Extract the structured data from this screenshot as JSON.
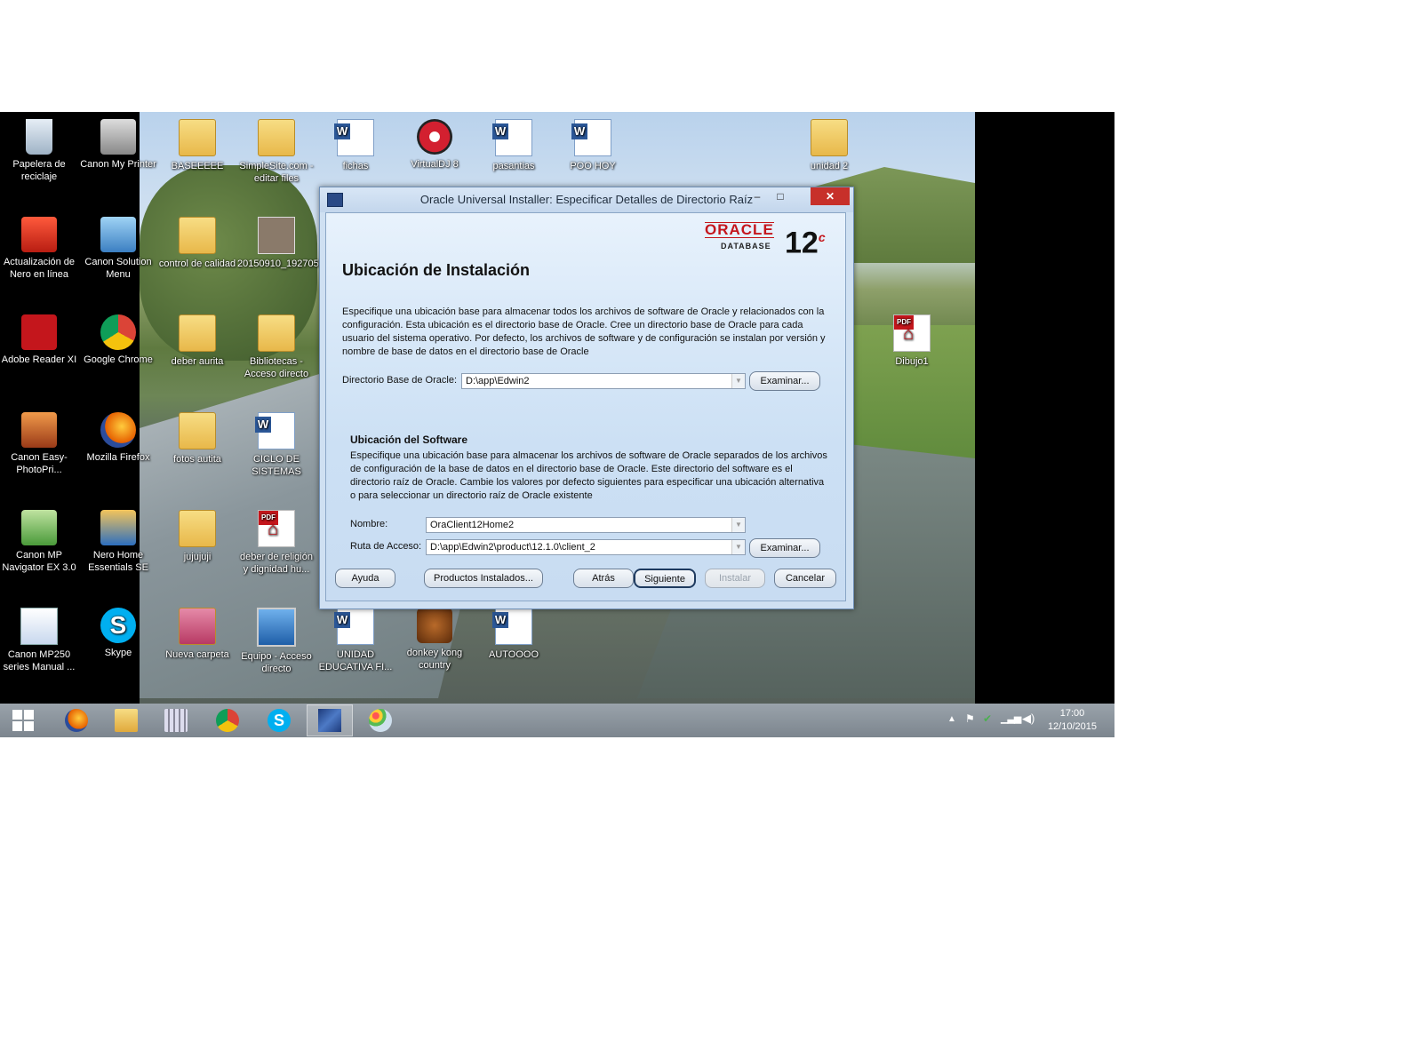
{
  "desktop": {
    "icons": [
      {
        "label": "Papelera de reciclaje"
      },
      {
        "label": "Canon My Printer"
      },
      {
        "label": "BASEEEEE"
      },
      {
        "label": "SimpleSite.com - editar files"
      },
      {
        "label": "fichas"
      },
      {
        "label": "VirtualDJ 8"
      },
      {
        "label": "pasantias"
      },
      {
        "label": "POO HOY"
      },
      {
        "label": "unidad 2"
      },
      {
        "label": "Actualización de Nero en línea"
      },
      {
        "label": "Canon Solution Menu"
      },
      {
        "label": "control de calidad"
      },
      {
        "label": "20150910_192705"
      },
      {
        "label": "Adobe Reader XI"
      },
      {
        "label": "Google Chrome"
      },
      {
        "label": "deber aurita"
      },
      {
        "label": "Bibliotecas - Acceso directo"
      },
      {
        "label": "Dibujo1"
      },
      {
        "label": "Canon Easy-PhotoPri..."
      },
      {
        "label": "Mozilla Firefox"
      },
      {
        "label": "fotos autita"
      },
      {
        "label": "CICLO DE SISTEMAS"
      },
      {
        "label": "Canon MP Navigator EX 3.0"
      },
      {
        "label": "Nero Home Essentials SE"
      },
      {
        "label": "jujujuji"
      },
      {
        "label": "deber de religión y dignidad hu..."
      },
      {
        "label": "Canon MP250 series Manual ..."
      },
      {
        "label": "Skype"
      },
      {
        "label": "Nueva carpeta"
      },
      {
        "label": "Equipo - Acceso directo"
      },
      {
        "label": "UNIDAD EDUCATIVA FI..."
      },
      {
        "label": "donkey kong country"
      },
      {
        "label": "AUTOOOO"
      }
    ]
  },
  "dialog": {
    "title": "Oracle Universal Installer: Especificar Detalles de Directorio Raíz",
    "window_buttons": {
      "minimize": "–",
      "maximize": "□",
      "close": "✕"
    },
    "logo": {
      "brand": "ORACLE",
      "product": "DATABASE",
      "version": "12",
      "version_suffix": "c"
    },
    "heading": "Ubicación de Instalación",
    "intro": "Especifique una ubicación base para almacenar todos los archivos de software de Oracle y relacionados con la configuración. Esta ubicación es el directorio base de Oracle. Cree un directorio base de Oracle para cada usuario del sistema operativo. Por defecto, los archivos de software y de configuración se instalan por versión y nombre de base de datos en el directorio base de Oracle",
    "oracle_base_label": "Directorio Base de Oracle:",
    "oracle_base_value": "D:\\app\\Edwin2",
    "browse_label": "Examinar...",
    "software_heading": "Ubicación del Software",
    "software_text": "Especifique una ubicación base para almacenar los archivos de software de Oracle separados de los archivos de configuración de la base de datos en el directorio base de Oracle. Este directorio del software es el directorio raíz de Oracle. Cambie los valores por defecto siguientes para especificar una ubicación alternativa o para seleccionar un directorio raíz de Oracle existente",
    "name_label": "Nombre:",
    "name_value": "OraClient12Home2",
    "path_label": "Ruta de Acceso:",
    "path_value": "D:\\app\\Edwin2\\product\\12.1.0\\client_2",
    "buttons": {
      "help": "Ayuda",
      "installed_products": "Productos Instalados...",
      "back": "Atrás",
      "next": "Siguiente",
      "install": "Instalar",
      "cancel": "Cancelar"
    }
  },
  "taskbar": {
    "items": [
      {
        "icon": "windows-start-icon"
      },
      {
        "icon": "firefox-icon"
      },
      {
        "icon": "file-explorer-icon"
      },
      {
        "icon": "keyboard-app-icon"
      },
      {
        "icon": "chrome-icon"
      },
      {
        "icon": "skype-icon"
      },
      {
        "icon": "oracle-installer-icon",
        "active": true
      },
      {
        "icon": "paint-icon"
      }
    ],
    "clock": {
      "time": "17:00",
      "date": "12/10/2015"
    }
  },
  "colors": {
    "oracle_red": "#c4161c",
    "close_red": "#c7302a",
    "taskbar": "#8a939b"
  }
}
